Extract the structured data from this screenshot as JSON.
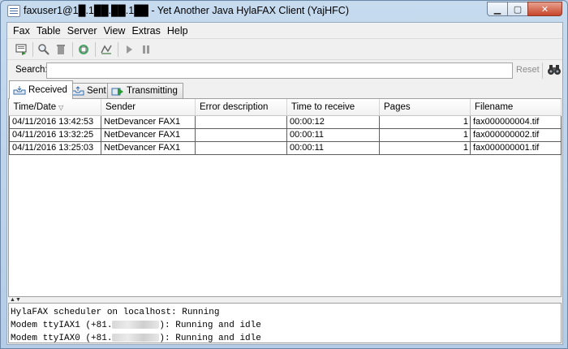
{
  "window": {
    "title": "faxuser1@1█.1██.██.1██ - Yet Another Java HylaFAX Client (YajHFC)",
    "controls": {
      "minimize": "▁",
      "maximize": "▢",
      "close": "✕"
    }
  },
  "menubar": [
    {
      "label": "Fax"
    },
    {
      "label": "Table"
    },
    {
      "label": "Server"
    },
    {
      "label": "View"
    },
    {
      "label": "Extras"
    },
    {
      "label": "Help"
    }
  ],
  "toolbar": {
    "icons": [
      "send-fax-icon",
      "view-fax-icon",
      "delete-icon",
      "refresh-icon",
      "mark-read-icon",
      "resume-icon",
      "pause-icon"
    ]
  },
  "search": {
    "label": "Search:",
    "value": "",
    "reset_label": "Reset"
  },
  "tabs": [
    {
      "label": "Received"
    },
    {
      "label": "Sent"
    },
    {
      "label": "Transmitting"
    }
  ],
  "table": {
    "headers": [
      "Time/Date",
      "Sender",
      "Error description",
      "Time to receive",
      "Pages",
      "Filename"
    ],
    "rows": [
      [
        "04/11/2016 13:42:53",
        "NetDevancer FAX1",
        "",
        "00:00:12",
        "1",
        "fax000000004.tif"
      ],
      [
        "04/11/2016 13:32:25",
        "NetDevancer FAX1",
        "",
        "00:00:11",
        "1",
        "fax000000002.tif"
      ],
      [
        "04/11/2016 13:25:03",
        "NetDevancer FAX1",
        "",
        "00:00:11",
        "1",
        "fax000000001.tif"
      ]
    ]
  },
  "status": {
    "line1": "HylaFAX scheduler on localhost: Running",
    "line2_prefix": "Modem ttyIAX1 (+81.",
    "line2_suffix": "): Running and idle",
    "line3_prefix": "Modem ttyIAX0 (+81.",
    "line3_suffix": "): Running and idle"
  },
  "colors": {
    "titlebar": "#bcd3ea",
    "panel": "#f0f0f0"
  }
}
